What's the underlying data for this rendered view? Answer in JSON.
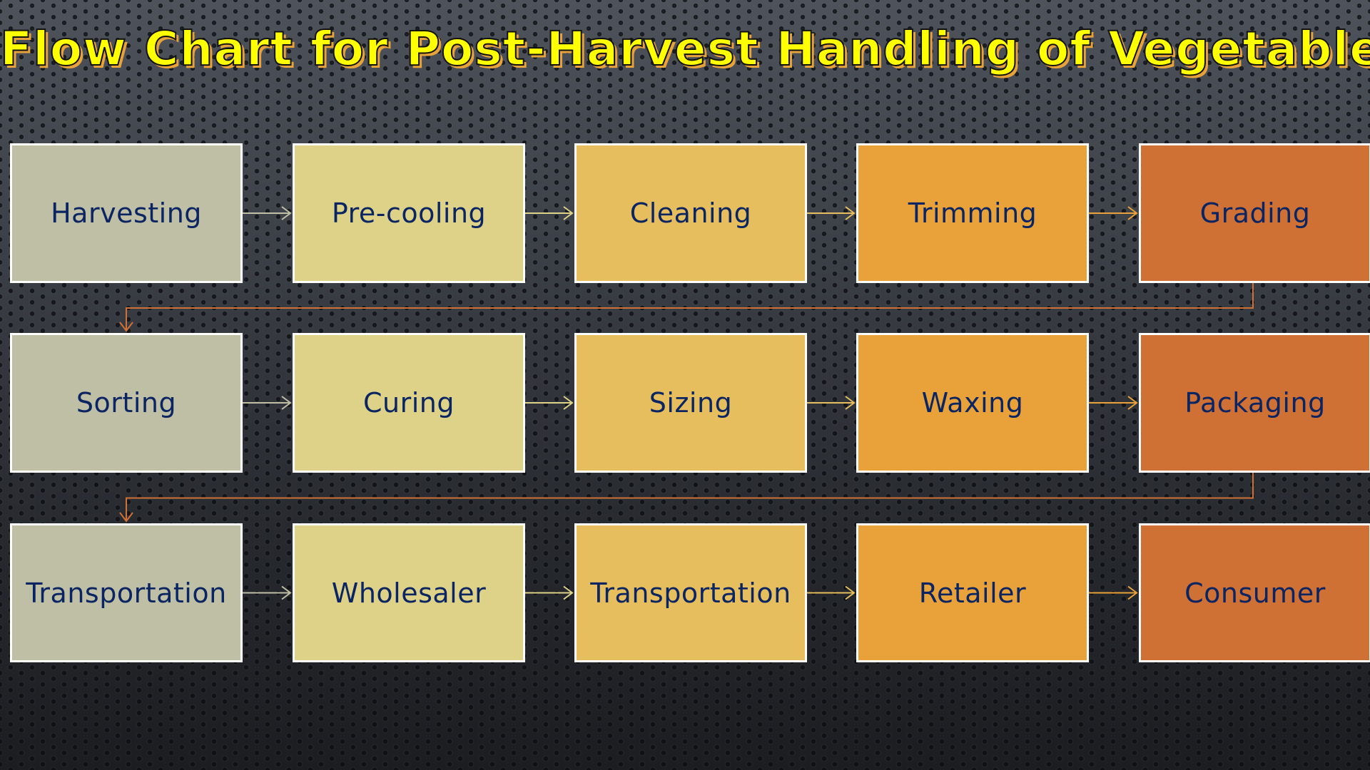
{
  "title": "Flow Chart for Post-Harvest Handling of Vegetables",
  "colors": {
    "title_fill": "#ffff00",
    "title_shadow": "#e8a23a",
    "text": "#0b2563",
    "column_fills": [
      "#bfbfa5",
      "#ddd288",
      "#e6be5e",
      "#e9a239",
      "#cf7035"
    ],
    "row_connector": "#cf7035"
  },
  "flow": {
    "rows": [
      {
        "steps": [
          "Harvesting",
          "Pre-cooling",
          "Cleaning",
          "Trimming",
          "Grading"
        ]
      },
      {
        "steps": [
          "Sorting",
          "Curing",
          "Sizing",
          "Waxing",
          "Packaging"
        ]
      },
      {
        "steps": [
          "Transportation",
          "Wholesaler",
          "Transportation",
          "Retailer",
          "Consumer"
        ]
      }
    ]
  }
}
